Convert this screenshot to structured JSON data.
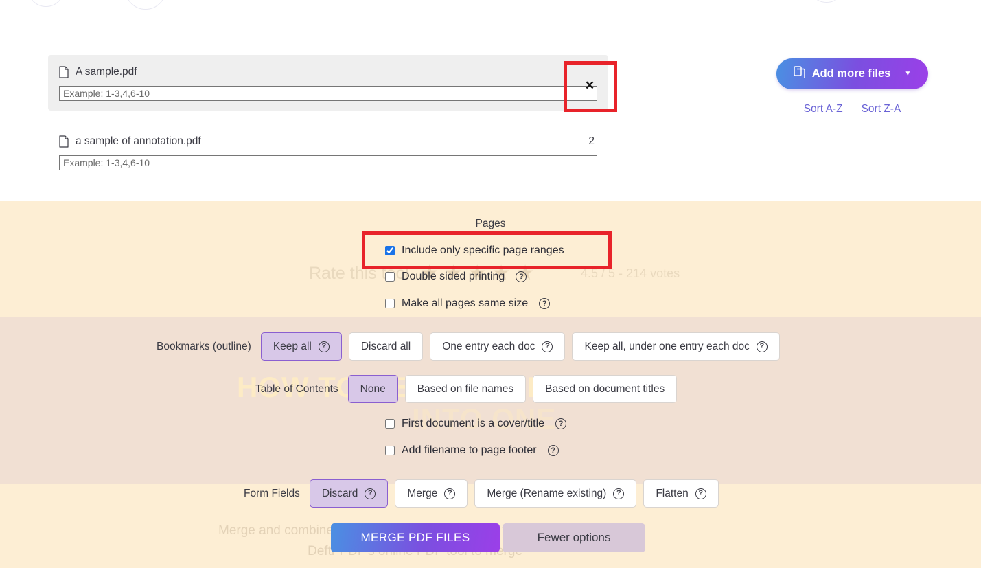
{
  "files": {
    "items": [
      {
        "name": "A sample.pdf",
        "page_count": "",
        "range_placeholder": "Example: 1-3,4,6-10",
        "range_value": ""
      },
      {
        "name": "a sample of annotation.pdf",
        "page_count": "2",
        "range_placeholder": "Example: 1-3,4,6-10",
        "range_value": ""
      }
    ],
    "remove_label": "✕"
  },
  "toolbar": {
    "add_more_files_label": "Add more files",
    "add_more_caret": "▼",
    "sort_az_label": "Sort A-Z",
    "sort_za_label": "Sort Z-A"
  },
  "pages": {
    "section_label": "Pages",
    "include_ranges_label": "Include only specific page ranges",
    "include_ranges_checked": true,
    "double_sided_label": "Double sided printing",
    "double_sided_checked": false,
    "same_size_label": "Make all pages same size",
    "same_size_checked": false
  },
  "bookmarks": {
    "label": "Bookmarks (outline)",
    "options": [
      {
        "label": "Keep all",
        "help": true,
        "selected": true
      },
      {
        "label": "Discard all",
        "help": false,
        "selected": false
      },
      {
        "label": "One entry each doc",
        "help": true,
        "selected": false
      },
      {
        "label": "Keep all, under one entry each doc",
        "help": true,
        "selected": false
      }
    ]
  },
  "table_of_contents": {
    "label": "Table of Contents",
    "options": [
      {
        "label": "None",
        "help": false,
        "selected": true
      },
      {
        "label": "Based on file names",
        "help": false,
        "selected": false
      },
      {
        "label": "Based on document titles",
        "help": false,
        "selected": false
      }
    ],
    "cover_label": "First document is a cover/title",
    "cover_checked": false,
    "footer_label": "Add filename to page footer",
    "footer_checked": false
  },
  "form_fields": {
    "label": "Form Fields",
    "options": [
      {
        "label": "Discard",
        "help": true,
        "selected": true
      },
      {
        "label": "Merge",
        "help": true,
        "selected": false
      },
      {
        "label": "Merge (Rename existing)",
        "help": true,
        "selected": false
      },
      {
        "label": "Flatten",
        "help": true,
        "selected": false
      }
    ]
  },
  "actions": {
    "merge_label": "MERGE PDF FILES",
    "fewer_options_label": "Fewer options"
  },
  "background_text": {
    "rate_this_tool": "Rate this tool",
    "stars": "★★★★★",
    "votes": "4.5 / 5 - 214 votes",
    "heading_line1": "HOW TO MERGE PDF FILES",
    "heading_line2": "INTO ONE",
    "paragraph_line1": "Merge and combine PDF files online, here's how to use",
    "paragraph_line2": "Deftr PDF's online PDF tool to merge"
  },
  "help_glyph": "?",
  "colors": {
    "accent_blue": "#4a90e2",
    "accent_purple": "#9b3fe8",
    "selected_chip": "#d8c8e8",
    "annotation_red": "#e8232a",
    "link": "#6a63d6",
    "band_cream": "#fdeed4",
    "band_pink": "#f1e0d3"
  }
}
